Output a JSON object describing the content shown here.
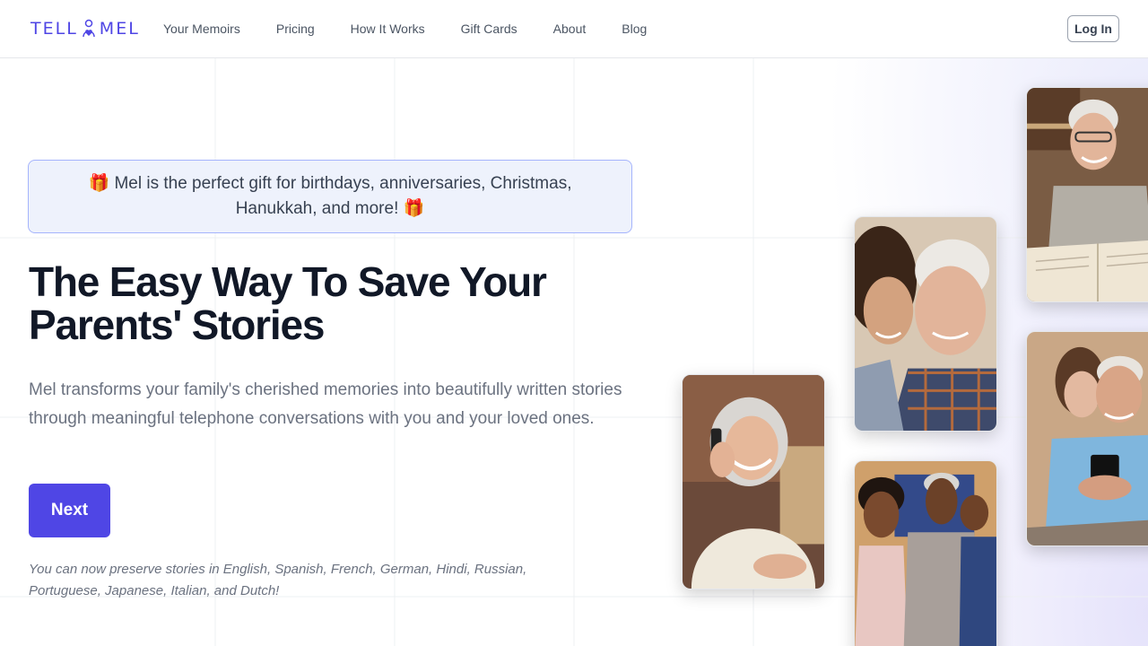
{
  "header": {
    "logo_left": "TELL",
    "logo_right": "MEL",
    "nav": [
      "Your Memoirs",
      "Pricing",
      "How It Works",
      "Gift Cards",
      "About",
      "Blog"
    ],
    "login_label": "Log In"
  },
  "hero": {
    "banner_text": "🎁 Mel is the perfect gift for birthdays, anniversaries, Christmas, Hanukkah, and more! 🎁",
    "headline": "The Easy Way To Save Your Parents' Stories",
    "subtitle": "Mel transforms your family's cherished memories into beautifully written stories through meaningful telephone conversations with you and your loved ones.",
    "next_label": "Next",
    "languages_note": "You can now preserve stories in English, Spanish, French, German, Hindi, Russian, Portuguese, Japanese, Italian, and Dutch!"
  },
  "colors": {
    "brand": "#4f46e5",
    "banner_bg": "#eef2fc",
    "banner_border": "#a5b4fc",
    "headline": "#111827",
    "body_text": "#6b7280"
  }
}
